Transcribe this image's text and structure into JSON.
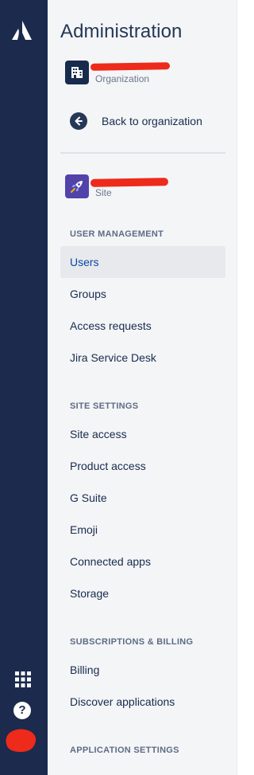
{
  "rail": {
    "logo_icon": "atlassian-logo-icon",
    "app_switcher_icon": "app-switcher-grid-icon",
    "help_icon": "help-icon",
    "help_glyph": "?",
    "avatar": "user-avatar",
    "background_color": "#1b2a4d"
  },
  "sidebar": {
    "title": "Administration",
    "organization": {
      "icon": "building-icon",
      "name": "",
      "type_label": "Organization"
    },
    "back_link": {
      "icon": "arrow-left-circle-icon",
      "label": "Back to organization"
    },
    "site": {
      "icon": "rocket-icon",
      "name": "",
      "type_label": "Site"
    },
    "sections": [
      {
        "heading": "USER MANAGEMENT",
        "items": [
          {
            "label": "Users",
            "selected": true
          },
          {
            "label": "Groups"
          },
          {
            "label": "Access requests"
          },
          {
            "label": "Jira Service Desk"
          }
        ]
      },
      {
        "heading": "SITE SETTINGS",
        "items": [
          {
            "label": "Site access"
          },
          {
            "label": "Product access"
          },
          {
            "label": "G Suite"
          },
          {
            "label": "Emoji"
          },
          {
            "label": "Connected apps"
          },
          {
            "label": "Storage"
          }
        ]
      },
      {
        "heading": "SUBSCRIPTIONS & BILLING",
        "items": [
          {
            "label": "Billing"
          },
          {
            "label": "Discover applications"
          }
        ]
      },
      {
        "heading": "APPLICATION SETTINGS",
        "items": []
      }
    ]
  },
  "colors": {
    "sidebar_bg": "#f4f5f7",
    "selected_text": "#0747a6",
    "selected_bg": "#e8e9ed",
    "redaction": "#ee2a1b"
  }
}
